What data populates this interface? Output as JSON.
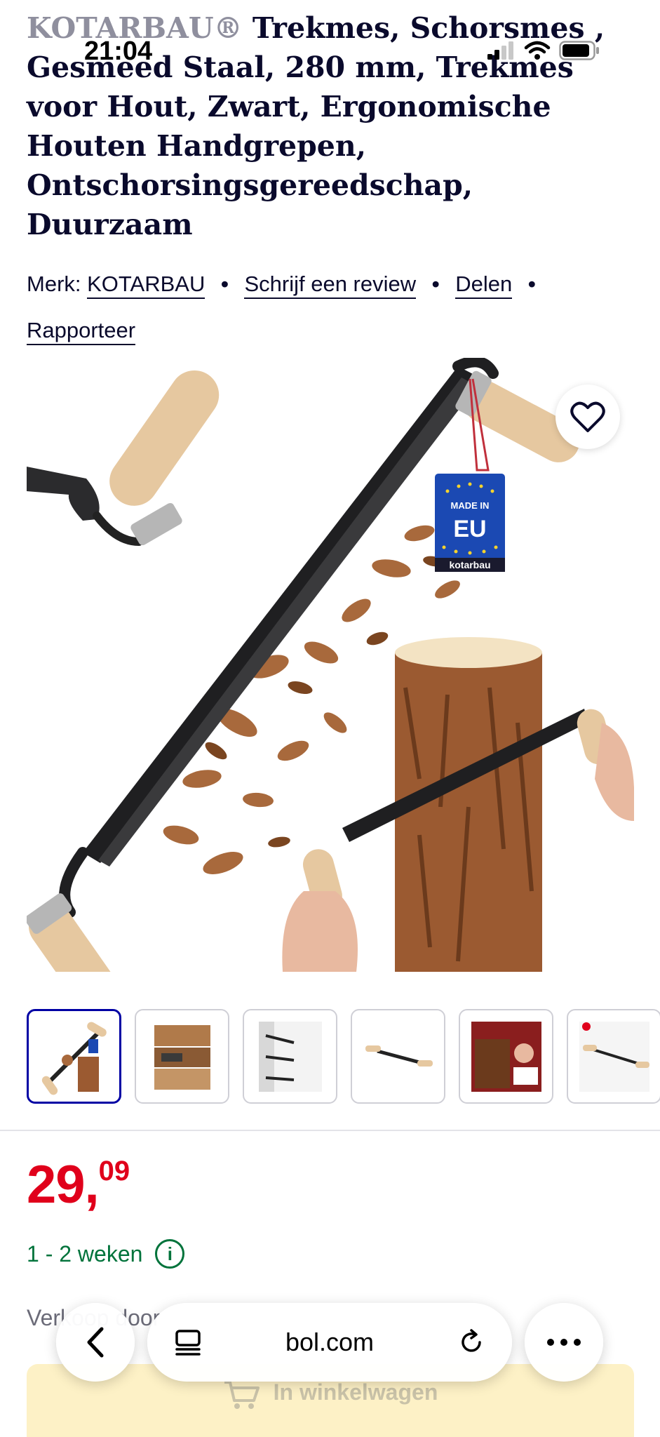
{
  "status_bar": {
    "time": "21:04"
  },
  "product": {
    "title_brand": "KOTARBAU",
    "title_trademark": "®",
    "title_rest": " Trekmes, Schorsmes , Gesmeed Staal, 280 mm, Trekmes voor Hout, Zwart, Ergonomische Houten Handgrepen, Ontschorsingsgereedschap, Duurzaam",
    "meta": {
      "brand_prefix": "Merk:",
      "brand_link": "KOTARBAU",
      "review_link": "Schrijf een review",
      "share_link": "Delen",
      "report_link": "Rapporteer",
      "separator": "•"
    },
    "image_tag": {
      "line1": "MADE IN",
      "line2": "EU",
      "brand": "kotarbau"
    },
    "thumbnails": [
      "thumbnail-1",
      "thumbnail-2",
      "thumbnail-3",
      "thumbnail-4",
      "thumbnail-5",
      "thumbnail-6"
    ],
    "price_integer": "29,",
    "price_decimal": "09",
    "delivery": "1 - 2 weken",
    "seller_prefix": "Verkoop door",
    "cart_button": "In winkelwagen"
  },
  "browser": {
    "url": "bol.com"
  },
  "colors": {
    "brand_blue": "#0000a4",
    "price_red": "#e0001b",
    "delivery_green": "#00733b",
    "cart_yellow": "#fdf1c6"
  },
  "icons": {
    "favorite": "heart-icon",
    "delivery_info": "info-icon",
    "back": "chevron-left-icon",
    "tabs": "tabs-icon",
    "reload": "reload-icon",
    "more": "more-icon",
    "cart": "cart-icon"
  }
}
